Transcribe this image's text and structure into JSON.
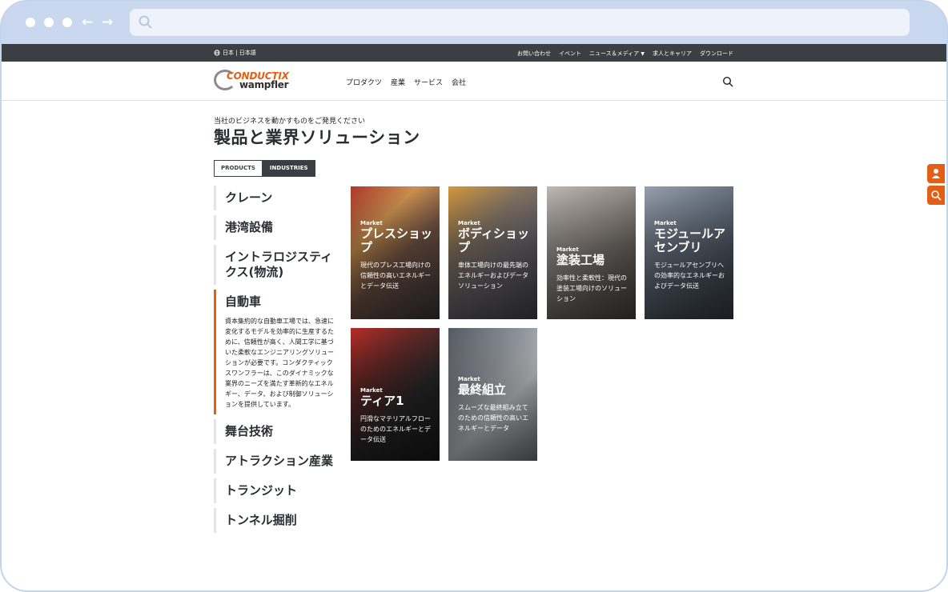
{
  "topbar": {
    "lang": "日本 | 日本語",
    "links": [
      "お問い合わせ",
      "イベント",
      "ニュース＆メディア",
      "求人とキャリア",
      "ダウンロード"
    ]
  },
  "logo": {
    "line1": "CONDUCTIX",
    "line2": "wampfler"
  },
  "nav": [
    "プロダクツ",
    "産業",
    "サービス",
    "会社"
  ],
  "hero": {
    "subtitle": "当社のビジネスを動かすものをご発見ください",
    "title": "製品と業界ソリューション"
  },
  "toggle": {
    "products": "PRODUCTS",
    "industries": "INDUSTRIES"
  },
  "sidebar": {
    "items": [
      {
        "label": "クレーン"
      },
      {
        "label": "港湾設備"
      },
      {
        "label": "イントラロジスティクス(物流)"
      },
      {
        "label": "自動車",
        "desc": "資本集約的な自動車工場では、急速に変化するモデルを効率的に生産するために、信頼性が高く、人間工学に基づいた柔軟なエンジニアリングソリューションが必要です。コンダクティックスワンフラーは、このダイナミックな業界のニーズを満たす革新的なエネルギー、データ、および制御ソリューションを提供しています。"
      },
      {
        "label": "舞台技術"
      },
      {
        "label": "アトラクション産業"
      },
      {
        "label": "トランジット"
      },
      {
        "label": "トンネル掘削"
      }
    ]
  },
  "cards": [
    {
      "market": "Market",
      "title": "プレスショップ",
      "desc": "現代のプレス工場向けの信頼性の高いエネルギーとデータ伝送"
    },
    {
      "market": "Market",
      "title": "ボディショップ",
      "desc": "車体工場向けの最先端のエネルギーおよびデータソリューション"
    },
    {
      "market": "Market",
      "title": "塗装工場",
      "desc": "効率性と柔軟性：現代の塗装工場向けのソリューション"
    },
    {
      "market": "Market",
      "title": "モジュールアセンブリ",
      "desc": "モジュールアセンブリへの効率的なエネルギーおよびデータ伝送"
    },
    {
      "market": "Market",
      "title": "ティア1",
      "desc": "円滑なマテリアルフローのためのエネルギーとデータ伝送"
    },
    {
      "market": "Market",
      "title": "最終組立",
      "desc": "スムーズな最終組み立てのための信頼性の高いエネルギーとデータ"
    }
  ],
  "colors": {
    "accent": "#e35f16",
    "dark": "#3b3f43"
  }
}
